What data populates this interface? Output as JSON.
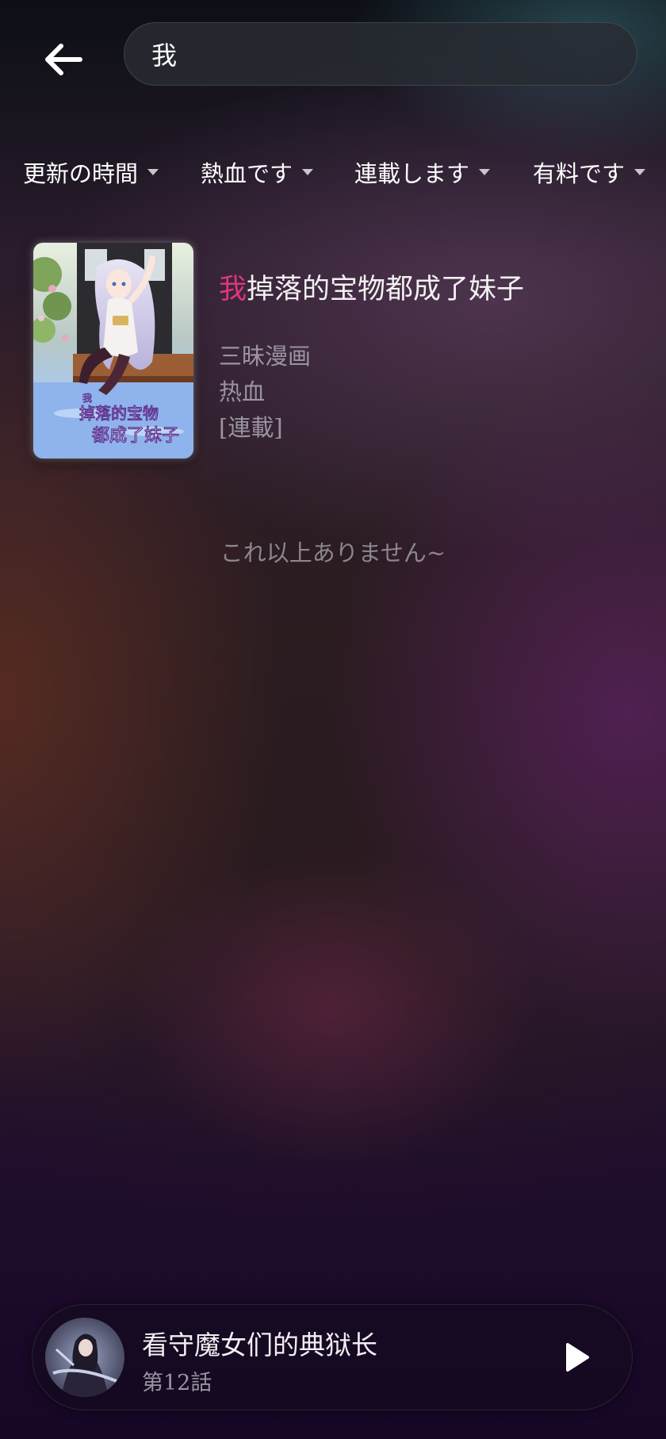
{
  "header": {
    "back_icon": "arrow-left-icon",
    "search": {
      "value": "我",
      "placeholder": ""
    }
  },
  "filters": [
    {
      "label": "更新の時間"
    },
    {
      "label": "熱血です"
    },
    {
      "label": "連載します"
    },
    {
      "label": "有料です"
    }
  ],
  "results": [
    {
      "title_highlight": "我",
      "title_rest": "掉落的宝物都成了妹子",
      "author": "三昧漫画",
      "genre": "热血",
      "status": "[連載]",
      "cover_text": "我掉落的宝物都成了妹子"
    }
  ],
  "end_message": "これ以上ありません~",
  "player": {
    "title": "看守魔女们的典狱长",
    "episode": "第12話",
    "play_icon": "play-icon"
  },
  "colors": {
    "highlight": "#e0357d",
    "muted_text": "#9a93a0",
    "text": "#f3f0f2"
  }
}
